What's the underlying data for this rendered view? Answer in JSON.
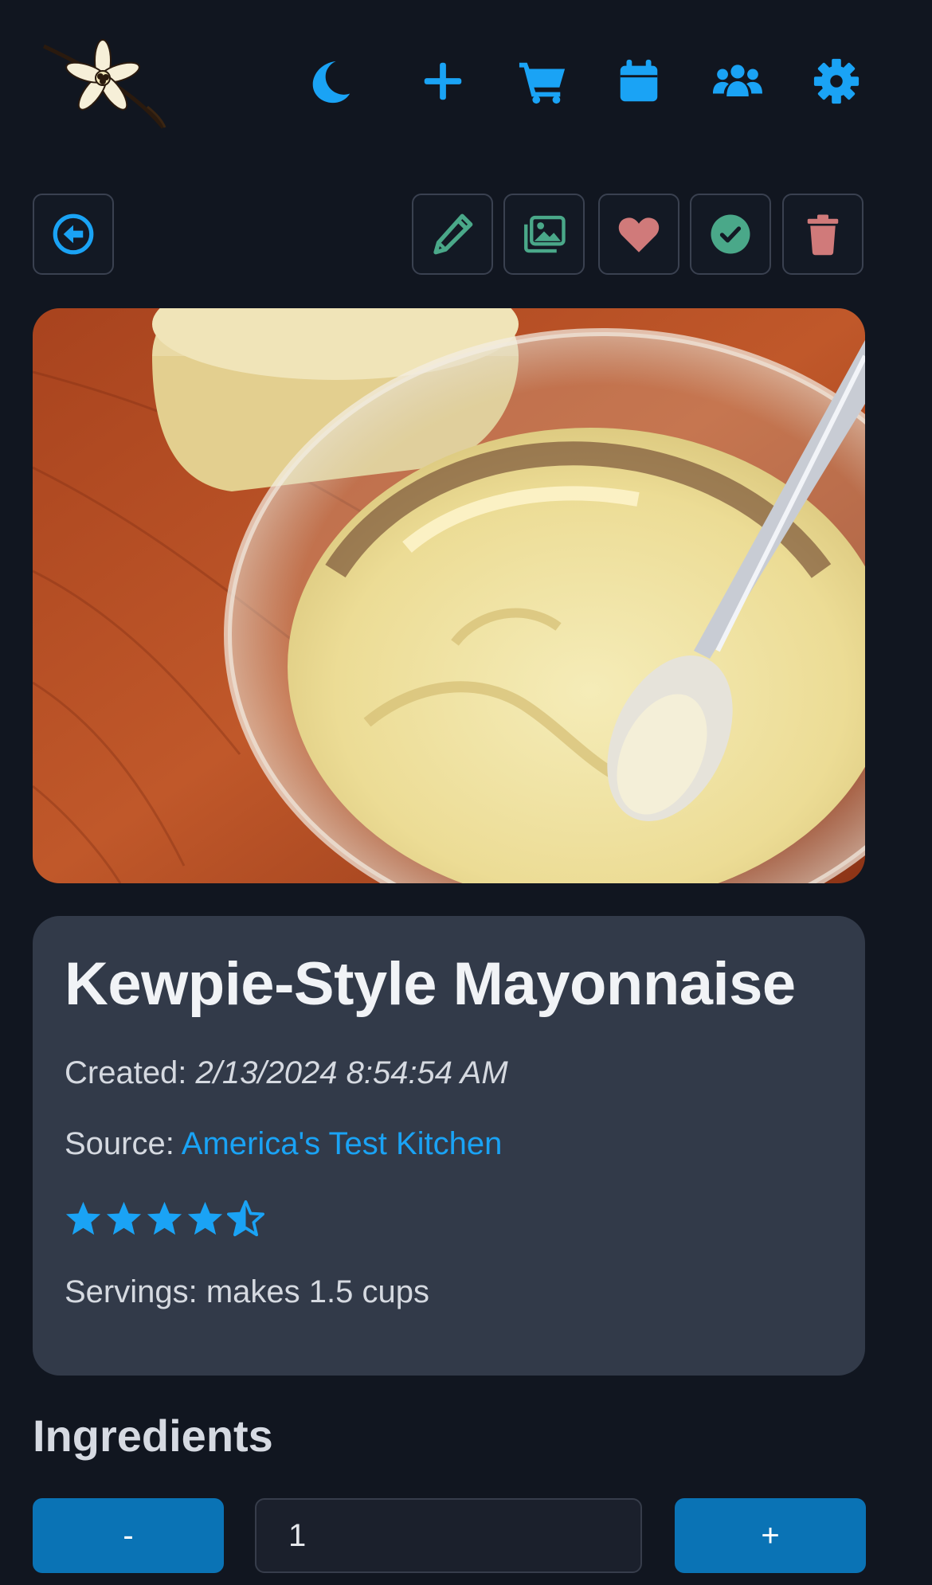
{
  "colors": {
    "accent": "#1aa3f5",
    "edit": "#4aa889",
    "heart": "#d07a7a",
    "check": "#4aa889",
    "trash": "#d07a7a",
    "button": "#0a73b5"
  },
  "header": {
    "logo_icon": "vanilla-flower-logo",
    "icons": [
      "moon-icon",
      "plus-icon",
      "cart-icon",
      "calendar-icon",
      "users-icon",
      "gear-icon"
    ]
  },
  "toolbar": {
    "back_icon": "circle-arrow-left-icon",
    "actions": [
      "pencil-icon",
      "images-icon",
      "heart-icon",
      "check-circle-icon",
      "trash-icon"
    ]
  },
  "recipe": {
    "title": "Kewpie-Style Mayonnaise",
    "created_label": "Created: ",
    "created_value": "2/13/2024 8:54:54 AM",
    "source_label": "Source: ",
    "source_value": "America's Test Kitchen",
    "rating": 4.5,
    "rating_max": 5,
    "servings": "Servings: makes 1.5 cups"
  },
  "ingredients": {
    "heading": "Ingredients",
    "decrement_label": "-",
    "quantity": "1",
    "increment_label": "+"
  }
}
